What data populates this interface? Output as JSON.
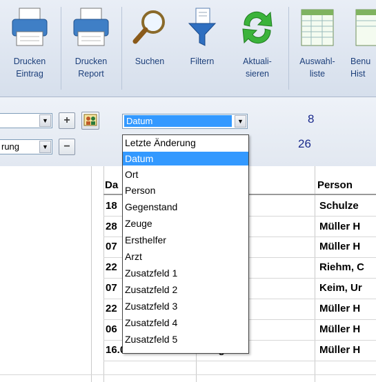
{
  "ribbon": {
    "buttons": [
      {
        "label": "Drucken\nEintrag",
        "icon": "printer-icon"
      },
      {
        "label": "Drucken\nReport",
        "icon": "printer-icon"
      },
      {
        "label": "Suchen",
        "icon": "magnifier-icon"
      },
      {
        "label": "Filtern",
        "icon": "funnel-icon"
      },
      {
        "label": "Aktuali-\nsieren",
        "icon": "refresh-icon"
      },
      {
        "label": "Auswahl-\nliste",
        "icon": "table-icon"
      },
      {
        "label": "Benu\nHist",
        "icon": "table-icon"
      }
    ]
  },
  "toolbar": {
    "combo1_value": "",
    "combo2_value": "rung",
    "sort_combo_value": "Datum",
    "count_top": "8",
    "count_bottom": "26",
    "plus_label": "+",
    "minus_label": "−"
  },
  "dropdown": {
    "selected": "Datum",
    "options": [
      "Letzte Änderung",
      "Datum",
      "Ort",
      "Person",
      "Gegenstand",
      "Zeuge",
      "Ersthelfer",
      "Arzt",
      "Zusatzfeld 1",
      "Zusatzfeld 2",
      "Zusatzfeld 3",
      "Zusatzfeld 4",
      "Zusatzfeld 5"
    ]
  },
  "table": {
    "headers": {
      "date": "Da",
      "person": "Person"
    },
    "rows": [
      {
        "date": "18",
        "person": "Schulze"
      },
      {
        "date": "28",
        "person": "Müller H"
      },
      {
        "date": "07",
        "person": "Müller H"
      },
      {
        "date": "22",
        "person": "Riehm, C"
      },
      {
        "date": "07",
        "person": "Keim, Ur"
      },
      {
        "date": "22",
        "person": "Müller H"
      },
      {
        "date": "06",
        "person": "Müller H"
      },
      {
        "date": "16.05.2013",
        "middle": "Zeuge",
        "person": "Müller H"
      }
    ]
  },
  "colors": {
    "accent": "#3399ff",
    "count": "#1a2a8c",
    "ribbon_label": "#1c3f7a"
  }
}
